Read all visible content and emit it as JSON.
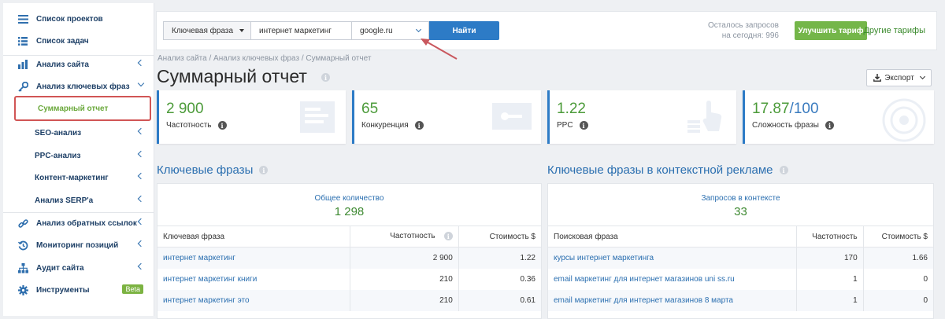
{
  "sidebar": {
    "items": [
      {
        "label": "Список проектов",
        "icon": "menu-icon"
      },
      {
        "label": "Список задач",
        "icon": "tasks-icon"
      },
      {
        "label": "Анализ сайта",
        "icon": "chart-icon"
      },
      {
        "label": "Анализ ключевых фраз",
        "icon": "key-icon"
      },
      {
        "label": "Суммарный отчет"
      },
      {
        "label": "SEO-анализ"
      },
      {
        "label": "PPC-анализ"
      },
      {
        "label": "Контент-маркетинг"
      },
      {
        "label": "Анализ SERP'a"
      },
      {
        "label": "Анализ обратных ссылок",
        "icon": "link-icon"
      },
      {
        "label": "Мониторинг позиций",
        "icon": "history-icon"
      },
      {
        "label": "Аудит сайта",
        "icon": "sitemap-icon"
      },
      {
        "label": "Инструменты",
        "icon": "gear-icon"
      }
    ],
    "beta_badge": "Beta"
  },
  "search": {
    "type_label": "Ключевая фраза",
    "query": "интернет маркетинг",
    "engine": "google.ru",
    "find_button": "Найти"
  },
  "account": {
    "remaining_line1": "Осталось запросов",
    "remaining_line2": "на сегодня: 996",
    "upgrade_button": "Улучшить тариф",
    "other_tariffs": "Другие тарифы"
  },
  "breadcrumb": "Анализ сайта / Анализ ключевых фраз / Суммарный отчет",
  "page_title": "Суммарный отчет",
  "export_button": "Экспорт",
  "cards": [
    {
      "value": "2 900",
      "suffix": "",
      "caption": "Частотность"
    },
    {
      "value": "65",
      "suffix": "",
      "caption": "Конкуренция"
    },
    {
      "value": "1.22",
      "suffix": "",
      "caption": "PPC"
    },
    {
      "value": "17.87",
      "suffix": "/100",
      "caption": "Сложность фразы"
    }
  ],
  "keywords": {
    "title": "Ключевые фразы",
    "total_label": "Общее количество",
    "total_value": "1 298",
    "columns": [
      "Ключевая фраза",
      "Частотность",
      "Стоимость $"
    ],
    "rows": [
      [
        "интернет маркетинг",
        "2 900",
        "1.22"
      ],
      [
        "интернет маркетинг книги",
        "210",
        "0.36"
      ],
      [
        "интернет маркетинг это",
        "210",
        "0.61"
      ]
    ]
  },
  "ads": {
    "title": "Ключевые фразы в контекстной рекламе",
    "total_label": "Запросов в контексте",
    "total_value": "33",
    "columns": [
      "Поисковая фраза",
      "Частотность",
      "Стоимость $"
    ],
    "rows": [
      [
        "курсы интернет маркетинга",
        "170",
        "1.66"
      ],
      [
        "email маркетинг для интернет магазинов uni ss.ru",
        "1",
        "0"
      ],
      [
        "email маркетинг для интернет магазинов 8 марта",
        "1",
        "0"
      ]
    ]
  },
  "colors": {
    "accent_blue": "#2d7bc6",
    "accent_green": "#74b649",
    "highlight_red": "#d15555"
  }
}
